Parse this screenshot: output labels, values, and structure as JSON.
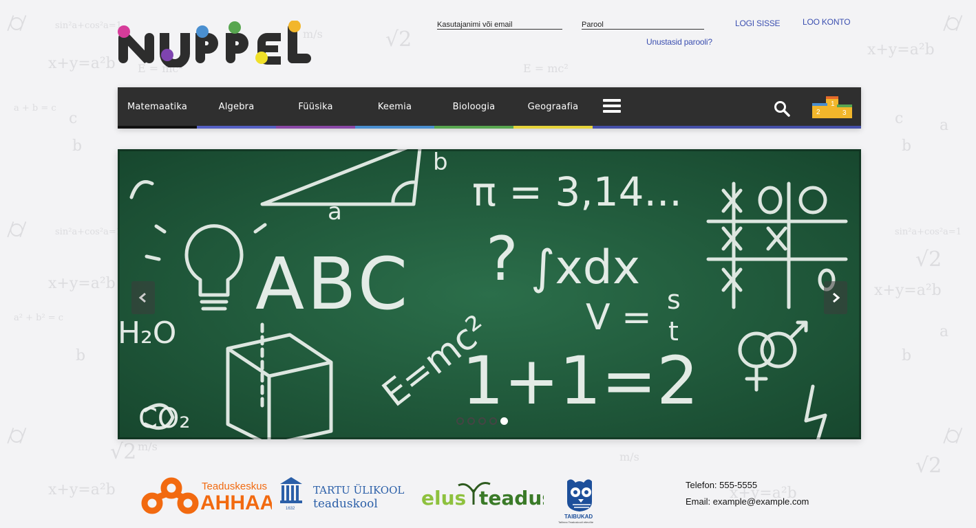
{
  "header": {
    "logo_text": "NUPPEL",
    "username_placeholder": "Kasutajanimi või email",
    "password_placeholder": "Parool",
    "login_label": "LOGI SISSE",
    "signup_label": "LOO KONTO",
    "forgot_label": "Unustasid parooli?"
  },
  "nav": {
    "items": [
      {
        "label": "Matemaatika",
        "color": "#111111"
      },
      {
        "label": "Algebra",
        "color": "#5561c4"
      },
      {
        "label": "Füüsika",
        "color": "#8a48a6"
      },
      {
        "label": "Keemia",
        "color": "#4a8fd0"
      },
      {
        "label": "Bioloogia",
        "color": "#58a650"
      },
      {
        "label": "Geograafia",
        "color": "#e6d43a"
      }
    ],
    "menu_icon": "hamburger-icon",
    "search_icon": "search-icon",
    "podium_icon": "podium-icon",
    "podium_numbers": [
      "1",
      "2",
      "3"
    ]
  },
  "slider": {
    "slide_count": 5,
    "active_index": 4,
    "chalk_text": {
      "abc": "ABC",
      "pi": "π = 3,14...",
      "integral": "∫xdx",
      "velocity_v": "V =",
      "velocity_s": "s",
      "velocity_t": "t",
      "emc": "E=mc²",
      "sum": "1+1=2",
      "h2o": "H₂O",
      "co2": "CO₂",
      "a": "a",
      "b": "b",
      "question": "?",
      "tictactoe_o": "O",
      "tictactoe_x": "X"
    }
  },
  "partners": [
    {
      "name": "Teaduskeskus",
      "sub": "AHHAA"
    },
    {
      "name": "TARTU ÜLIKOOL",
      "sub": "teaduskool",
      "year": "1632"
    },
    {
      "name": "elus",
      "sub": "teadus"
    },
    {
      "name": "TAIBUKAD",
      "sub": "Tallinna Teaduskooli ettevõte"
    }
  ],
  "contact": {
    "phone": "Telefon: 555-5555",
    "email": "Email: example@example.com"
  },
  "colors": {
    "accent_blue": "#3b4fb0",
    "nav_bg": "#2f2f2f",
    "board_green": "#1f5a3b",
    "ahhaa_orange": "#f26a10"
  }
}
